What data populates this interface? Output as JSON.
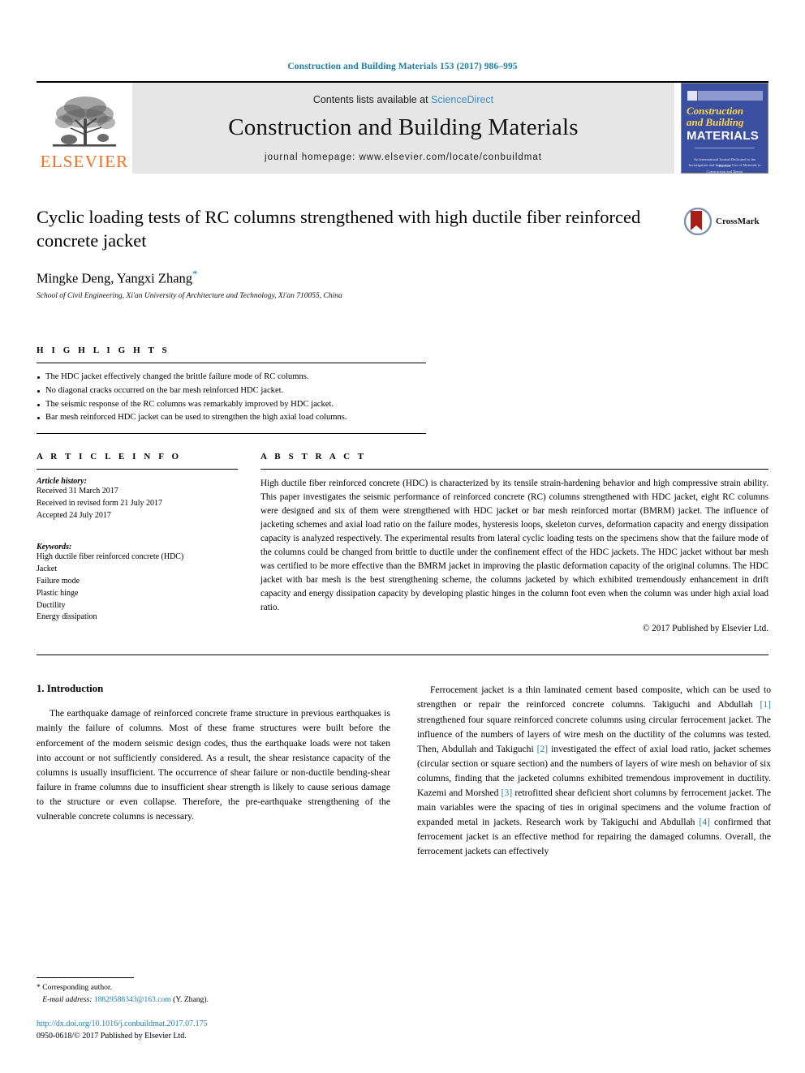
{
  "running_head": "Construction and Building Materials 153 (2017) 986–995",
  "masthead": {
    "contents_prefix": "Contents lists available at ",
    "sciencedirect": "ScienceDirect",
    "journal_title": "Construction and Building Materials",
    "homepage": "journal homepage: www.elsevier.com/locate/conbuildmat",
    "publisher_logo_text": "ELSEVIER",
    "cover": {
      "line1": "Construction",
      "line2": "and Building",
      "line3": "MATERIALS",
      "subtitle": "An International Journal Dedicated to the Investigation and Innovative Use of Materials in Construction and Repair",
      "footer": "Elsevier"
    },
    "accent_color": "#3a8fd0",
    "band_color": "#e6e6e6",
    "elsevier_orange": "#f37021",
    "cover_blue": "#3a4fa0"
  },
  "article": {
    "title": "Cyclic loading tests of RC columns strengthened with high ductile fiber reinforced concrete jacket",
    "authors": "Mingke Deng, Yangxi Zhang",
    "corresponding_marker": "*",
    "affiliation": "School of Civil Engineering, Xi'an University of Architecture and Technology, Xi'an 710055, China",
    "crossmark_label": "CrossMark"
  },
  "highlights": {
    "heading": "H I G H L I G H T S",
    "items": [
      "The HDC jacket effectively changed the brittle failure mode of RC columns.",
      "No diagonal cracks occurred on the bar mesh reinforced HDC jacket.",
      "The seismic response of the RC columns was remarkably improved by HDC jacket.",
      "Bar mesh reinforced HDC jacket can be used to strengthen the high axial load columns."
    ]
  },
  "article_info": {
    "heading": "A R T I C L E    I N F O",
    "history_label": "Article history:",
    "history": [
      "Received 31 March 2017",
      "Received in revised form 21 July 2017",
      "Accepted 24 July 2017"
    ],
    "keywords_label": "Keywords:",
    "keywords": [
      "High ductile fiber reinforced concrete (HDC)",
      "Jacket",
      "Failure mode",
      "Plastic hinge",
      "Ductility",
      "Energy dissipation"
    ]
  },
  "abstract": {
    "heading": "A B S T R A C T",
    "text": "High ductile fiber reinforced concrete (HDC) is characterized by its tensile strain-hardening behavior and high compressive strain ability. This paper investigates the seismic performance of reinforced concrete (RC) columns strengthened with HDC jacket, eight RC columns were designed and six of them were strengthened with HDC jacket or bar mesh reinforced mortar (BMRM) jacket. The influence of jacketing schemes and axial load ratio on the failure modes, hysteresis loops, skeleton curves, deformation capacity and energy dissipation capacity is analyzed respectively. The experimental results from lateral cyclic loading tests on the specimens show that the failure mode of the columns could be changed from brittle to ductile under the confinement effect of the HDC jackets. The HDC jacket without bar mesh was certified to be more effective than the BMRM jacket in improving the plastic deformation capacity of the original columns. The HDC jacket with bar mesh is the best strengthening scheme, the columns jacketed by which exhibited tremendously enhancement in drift capacity and energy dissipation capacity by developing plastic hinges in the column foot even when the column was under high axial load ratio.",
    "copyright": "© 2017 Published by Elsevier Ltd."
  },
  "body": {
    "section_heading": "1. Introduction",
    "left_paragraph": "The earthquake damage of reinforced concrete frame structure in previous earthquakes is mainly the failure of columns. Most of these frame structures were built before the enforcement of the modern seismic design codes, thus the earthquake loads were not taken into account or not sufficiently considered. As a result, the shear resistance capacity of the columns is usually insufficient. The occurrence of shear failure or non-ductile bending-shear failure in frame columns due to insufficient shear strength is likely to cause serious damage to the structure or even collapse. Therefore, the pre-earthquake strengthening of the vulnerable concrete columns is necessary.",
    "right_paragraph_parts": [
      "Ferrocement jacket is a thin laminated cement based composite, which can be used to strengthen or repair the reinforced concrete columns. Takiguchi and Abdullah ",
      "[1]",
      " strengthened four square reinforced concrete columns using circular ferrocement jacket. The influence of the numbers of layers of wire mesh on the ductility of the columns was tested. Then, Abdullah and Takiguchi ",
      "[2]",
      " investigated the effect of axial load ratio, jacket schemes (circular section or square section) and the numbers of layers of wire mesh on behavior of six columns, finding that the jacketed columns exhibited tremendous improvement in ductility. Kazemi and Morshed ",
      "[3]",
      " retrofitted shear deficient short columns by ferrocement jacket. The main variables were the spacing of ties in original specimens and the volume fraction of expanded metal in jackets. Research work by Takiguchi and Abdullah ",
      "[4]",
      " confirmed that ferrocement jacket is an effective method for repairing the damaged columns. Overall, the ferrocement jackets can effectively"
    ]
  },
  "footnote": {
    "corresponding": "* Corresponding author.",
    "email_label": "E-mail address:",
    "email": "18829588343@163.com",
    "email_suffix": "(Y. Zhang).",
    "doi": "http://dx.doi.org/10.1016/j.conbuildmat.2017.07.175",
    "issn": "0950-0618/© 2017 Published by Elsevier Ltd.",
    "link_color": "#1b7fa8"
  }
}
